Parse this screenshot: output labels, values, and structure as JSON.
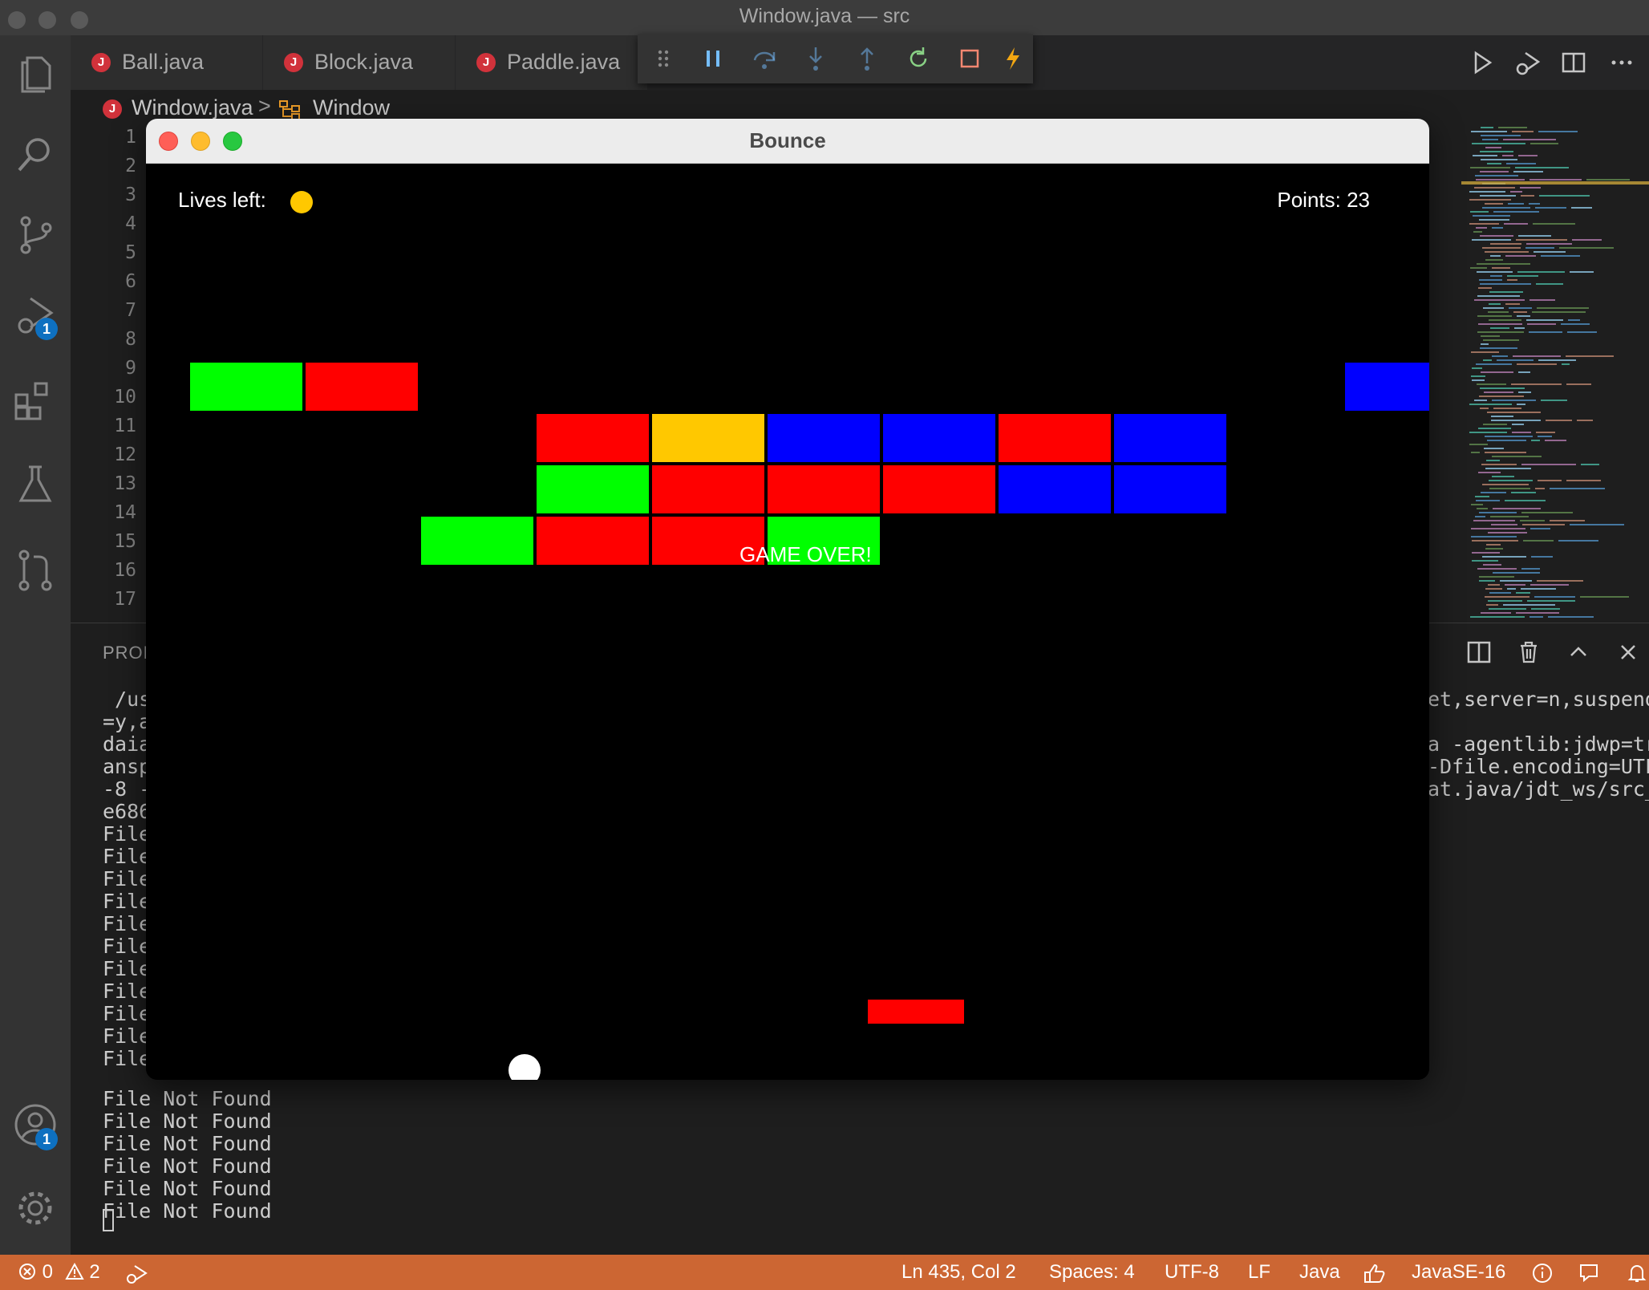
{
  "window": {
    "title": "Window.java — src"
  },
  "tabs": [
    {
      "label": "Ball.java"
    },
    {
      "label": "Block.java"
    },
    {
      "label": "Paddle.java"
    }
  ],
  "debug_toolbar": [
    "drag-handle",
    "pause",
    "step-over",
    "step-into",
    "step-out",
    "restart",
    "stop",
    "hot-code-replace"
  ],
  "breadcrumb": {
    "file": "Window.java",
    "separator": ">",
    "symbol": "Window",
    "file_icon_letter": "J"
  },
  "editor": {
    "line_numbers": [
      "1",
      "2",
      "3",
      "4",
      "5",
      "6",
      "7",
      "8",
      "9",
      "10",
      "11",
      "12",
      "13",
      "14",
      "15",
      "16",
      "17"
    ]
  },
  "activity_badges": {
    "run_debug": "1",
    "accounts": "1"
  },
  "panel": {
    "tab_label": "PROE",
    "left_lines": [
      " /us",
      "=y,a",
      "daia",
      "ansp",
      "-8 -",
      "e686",
      "File",
      "File",
      "File",
      "File",
      "File",
      "File",
      "File",
      "File",
      "File",
      "File",
      "File"
    ],
    "right_lines": [
      "et,server=n,suspend",
      "",
      "a -agentlib:jdwp=tr",
      "-Dfile.encoding=UTF",
      "at.java/jdt_ws/src_"
    ],
    "bottom_lines": [
      "File Not Found",
      "File Not Found",
      "File Not Found",
      "File Not Found",
      "File Not Found",
      "File Not Found"
    ]
  },
  "statusbar": {
    "errors": "0",
    "warnings": "2",
    "position": "Ln 435, Col 2",
    "spaces": "Spaces: 4",
    "encoding": "UTF-8",
    "eol": "LF",
    "language": "Java",
    "jdk": "JavaSE-16"
  },
  "game": {
    "title": "Bounce",
    "lives_label": "Lives left:",
    "lives_remaining": 1,
    "points_label": "Points: 23",
    "game_over": "GAME OVER!",
    "colors": {
      "green": "#00ff00",
      "red": "#ff0000",
      "blue": "#0000ff",
      "yellow": "#ffc800"
    },
    "bricks": [
      {
        "row": 0,
        "col": 0,
        "color": "green"
      },
      {
        "row": 0,
        "col": 1,
        "color": "red"
      },
      {
        "row": 0,
        "col": 10,
        "color": "blue"
      },
      {
        "row": 1,
        "col": 3,
        "color": "red"
      },
      {
        "row": 1,
        "col": 4,
        "color": "yellow"
      },
      {
        "row": 1,
        "col": 5,
        "color": "blue"
      },
      {
        "row": 1,
        "col": 6,
        "color": "blue"
      },
      {
        "row": 1,
        "col": 7,
        "color": "red"
      },
      {
        "row": 1,
        "col": 8,
        "color": "blue"
      },
      {
        "row": 2,
        "col": 3,
        "color": "green"
      },
      {
        "row": 2,
        "col": 4,
        "color": "red"
      },
      {
        "row": 2,
        "col": 5,
        "color": "red"
      },
      {
        "row": 2,
        "col": 6,
        "color": "red"
      },
      {
        "row": 2,
        "col": 7,
        "color": "blue"
      },
      {
        "row": 2,
        "col": 8,
        "color": "blue"
      },
      {
        "row": 3,
        "col": 2,
        "color": "green"
      },
      {
        "row": 3,
        "col": 3,
        "color": "red"
      },
      {
        "row": 3,
        "col": 4,
        "color": "red"
      },
      {
        "row": 3,
        "col": 5,
        "color": "green"
      }
    ]
  }
}
